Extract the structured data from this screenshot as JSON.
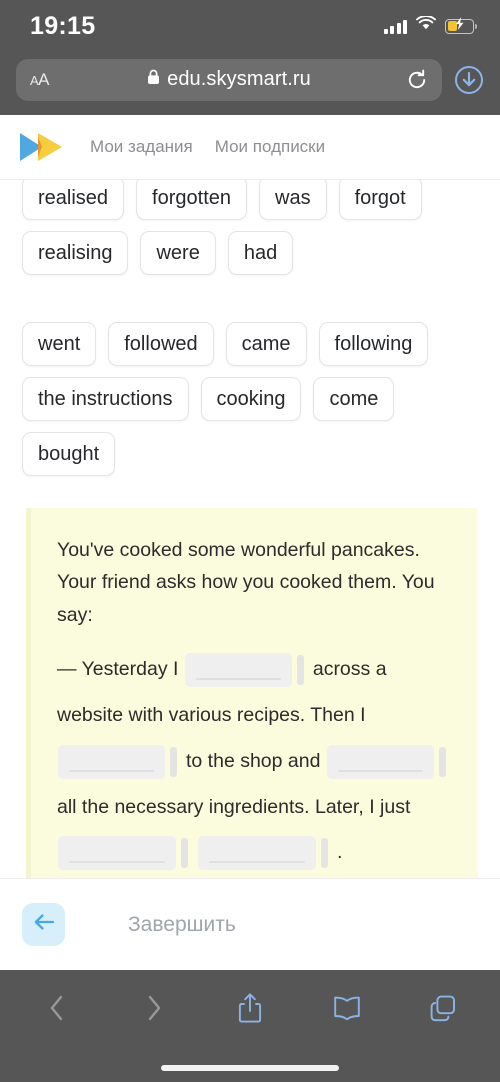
{
  "status_bar": {
    "time": "19:15",
    "signal_icon": "cellular-signal-icon",
    "wifi_icon": "wifi-icon",
    "battery_icon": "battery-charging-icon"
  },
  "browser": {
    "text_size_label": "AA",
    "lock_icon": "lock-icon",
    "url": "edu.skysmart.ru",
    "reload_icon": "reload-icon",
    "downloads_icon": "downloads-icon",
    "toolbar": {
      "back_icon": "chevron-left-icon",
      "forward_icon": "chevron-right-icon",
      "share_icon": "share-icon",
      "bookmarks_icon": "book-icon",
      "tabs_icon": "tabs-icon"
    },
    "colors": {
      "chrome_bg": "#565656",
      "url_bar_bg": "#6e6e6e",
      "accent": "#8ab4e8",
      "disabled": "#9a9a9a"
    }
  },
  "site": {
    "logo_name": "skysmart-logo",
    "logo_colors": {
      "blue": "#4FA8E0",
      "yellow": "#F5CE3E",
      "orange": "#F0922B"
    },
    "nav": [
      {
        "label": "Мои задания"
      },
      {
        "label": "Мои подписки"
      }
    ]
  },
  "word_bank": {
    "groups": [
      {
        "chips": [
          "realised",
          "forgotten",
          "was",
          "forgot",
          "realising",
          "were",
          "had"
        ]
      },
      {
        "chips": [
          "went",
          "followed",
          "came",
          "following",
          "the instructions",
          "cooking",
          "come",
          "bought"
        ]
      }
    ]
  },
  "task": {
    "intro": "You've cooked some wonderful pancakes. Your friend asks how you cooked them. You say:",
    "segments": {
      "s1": "— Yesterday I",
      "s2": "across a website with various recipes. Then I",
      "s3": "to the shop and",
      "s4": "all the necessary ingredients.",
      "s5": "Later, I just",
      "s6": "."
    },
    "blank_count": 5,
    "card_bg": "#fbfbdd"
  },
  "footer": {
    "back_icon": "arrow-left-icon",
    "finish_label": "Завершить"
  }
}
